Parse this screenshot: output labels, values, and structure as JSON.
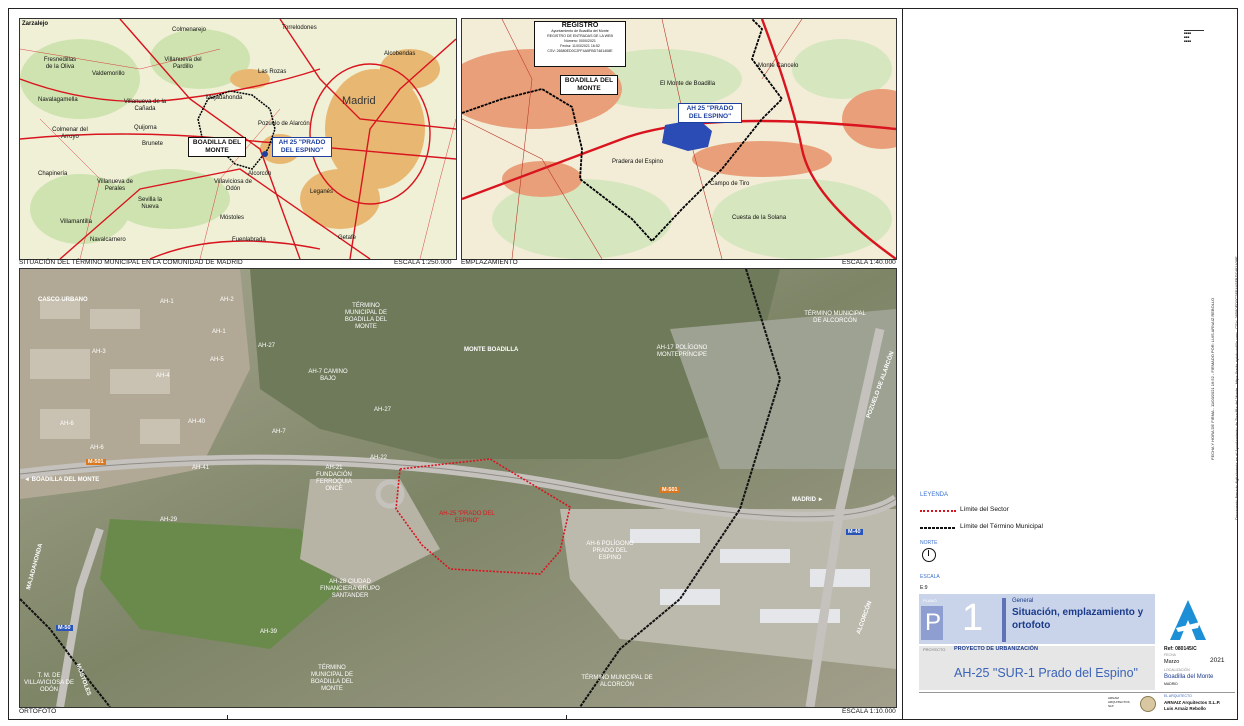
{
  "panels": {
    "situacion": {
      "caption": "SITUACIÓN DEL TÉRMINO MUNICIPAL EN LA COMUNIDAD DE MADRID",
      "scale": "ESCALA 1:250.000"
    },
    "emplazamiento": {
      "caption": "EMPLAZAMIENTO",
      "scale": "ESCALA 1:40.000"
    },
    "ortofoto": {
      "caption": "ORTOFOTO",
      "scale": "ESCALA 1:10.000"
    }
  },
  "situacion_labels": {
    "boadilla": "BOADILLA DEL MONTE",
    "ah25": "AH 25 \"PRADO DEL ESPINO\"",
    "madrid": "Madrid",
    "towns": [
      "Zarzalejo",
      "Colmenarejo",
      "Torrelodones",
      "Fresnedillas de la Oliva",
      "Valdemorillo",
      "Villanueva del Pardillo",
      "Las Rozas",
      "Alcobendas",
      "Navalagamella",
      "Villanueva de la Cañada",
      "Majadahonda",
      "Quijorna",
      "Brunete",
      "Colmenar del Arroyo",
      "Chapinería",
      "Villanueva de Perales",
      "Villaviciosa de Odón",
      "Alcorcón",
      "Leganés",
      "Getafe",
      "Villamantilla",
      "Sevilla la Nueva",
      "Móstoles",
      "Fuenlabrada",
      "Navalcarnero",
      "Pozuelo de Alarcón"
    ]
  },
  "emplazamiento_labels": {
    "registro_title": "REGISTRO",
    "registro_lines": [
      "Ayuntamiento de Boadilla del Monte",
      "REGISTRO DE ENTRADAS DE LA WEB",
      "Número: 0000/2021",
      "Fecha: 11/03/2021 16:52",
      "CSV: 26580ED0C2FF4A5FBD7481408E"
    ],
    "boadilla": "BOADILLA DEL MONTE",
    "ah25": "AH 25 \"PRADO DEL ESPINO\"",
    "places": [
      "El Monte de Boadilla",
      "Monte Cancelo",
      "Campo de Tiro",
      "Pradera del Espino",
      "Cuesta de la Solana"
    ]
  },
  "ortofoto_labels": {
    "sectors": [
      "CASCO URBANO",
      "AH-1",
      "AH-2",
      "AH-3",
      "AH-4",
      "AH-5",
      "AH-6",
      "AH-7",
      "AH-27",
      "AH-40",
      "AH-41",
      "AH-22",
      "AH-29",
      "AH-39"
    ],
    "camino_bajo": "AH-7 CAMINO BAJO",
    "monte_boadilla": "MONTE BOADILLA",
    "termino_boadilla_top": "TÉRMINO MUNICIPAL DE BOADILLA DEL MONTE",
    "termino_alcorcon_top": "TÉRMINO MUNICIPAL DE ALCORCÓN",
    "ah17": "AH-17 POLÍGONO MONTEPRÍNCIPE",
    "ah21": "AH-21 FUNDACIÓN FERROQUIA ONCE",
    "ah25": "AH-25 \"PRADO DEL ESPINO\"",
    "ah6": "AH-6 POLÍGONO PRADO DEL ESPINO",
    "ah28": "AH-28 CIUDAD FINANCIERA GRUPO SANTANDER",
    "termino_boadilla_bottom": "TÉRMINO MUNICIPAL DE BOADILLA DEL MONTE",
    "termino_alcorcon_bottom": "TÉRMINO MUNICIPAL DE ALCORCÓN",
    "termino_villaviciosa": "T. M. DE VILLAVICIOSA DE ODÓN",
    "road_m501_left": "M-501",
    "road_m501_right": "M-501",
    "to_boadilla": "BOADILLA DEL MONTE",
    "to_madrid": "MADRID",
    "to_pozuelo": "POZUELO DE ALARCÓN",
    "to_alcorcon": "ALCORCÓN",
    "to_majadahonda": "MAJADAHONDA",
    "to_mostoles": "MÓSTOLES",
    "m40": "M-40",
    "m50": "M-50"
  },
  "legend": {
    "title": "LEYENDA",
    "items": [
      {
        "label": "Límite del Sector",
        "color": "#d9141e"
      },
      {
        "label": "Límite del Término Municipal",
        "color": "#111111"
      }
    ],
    "north_label": "NORTE",
    "scale_label": "ESCALA",
    "scale_value": "E:9"
  },
  "titleblock": {
    "plano_label": "PLANO",
    "plano_letter": "P",
    "plano_number": "1",
    "category": "General",
    "title": "Situación, emplazamiento y ortofoto",
    "proyecto_label": "PROYECTO",
    "proyecto": "PROYECTO DE URBANIZACIÓN",
    "ref": "Ref: 080145/C",
    "fecha_label": "FECHA",
    "month": "Marzo",
    "year": "2021",
    "project_name": "AH-25 \"SUR-1 Prado del Espino\"",
    "location_label": "LOCALIZACIÓN",
    "location": "Boadilla del Monte",
    "region": "MADRID",
    "architect_label": "EL ARQUITECTO",
    "architect_firm": "ARNAIZ Arquitectos S.L.P.",
    "architect": "Luis Arnaiz Rebollo",
    "footer_firm": "ARNAIZ ARQUITECTOS SLP"
  },
  "side_text": {
    "line1": "Documento firmado digitalmente en el Ayuntamiento de Boadilla del Monte - https://sede.aytoboadilla.com - CSV: 26580ED0C2FF4A5FBD7481408E",
    "line2": "FECHA Y HORA DE FIRMA - 11/03/2021 16:52 - FIRMADO POR: LUIS ARNAIZ REBOLLO"
  },
  "colors": {
    "sector_limit": "#d9141e",
    "boundary": "#111111",
    "plano_blue": "#c9d4ea",
    "brand_blue": "#1c8fd6",
    "ah25_fill": "#2b4bb5"
  }
}
